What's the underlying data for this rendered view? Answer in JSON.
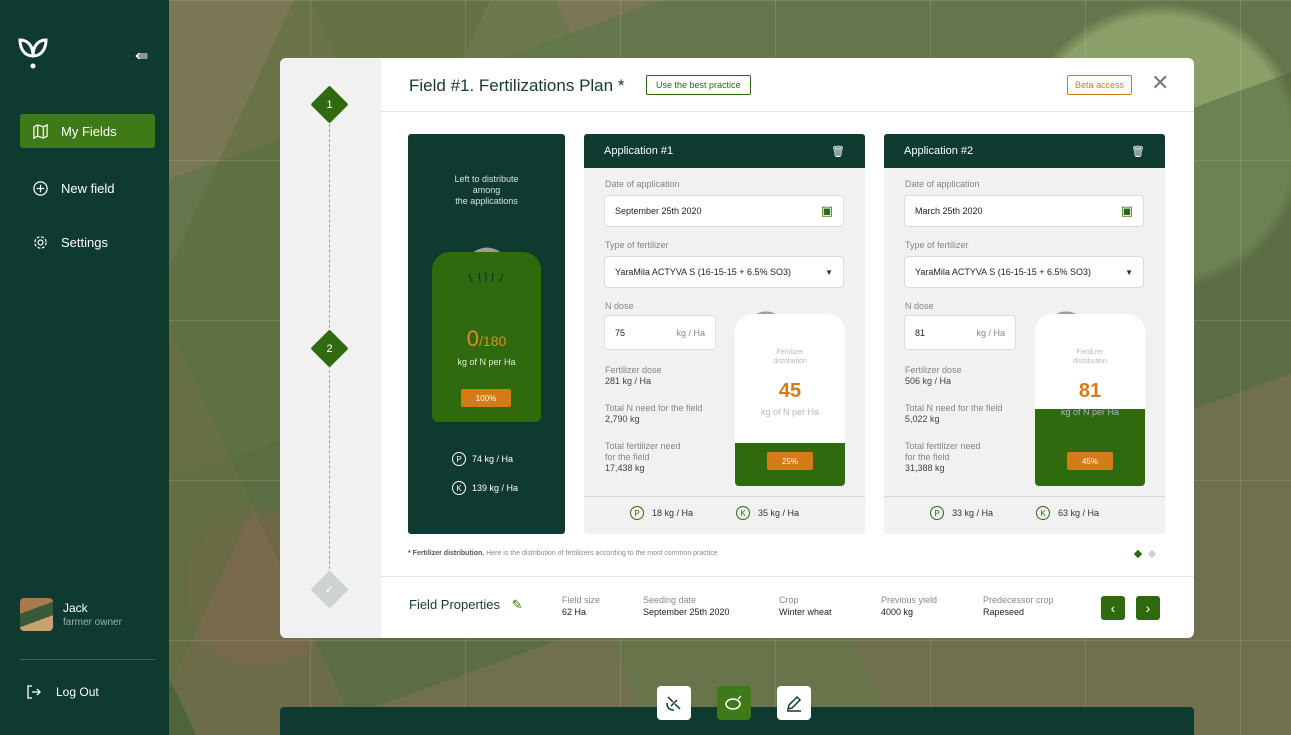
{
  "sidebar": {
    "items": [
      {
        "label": "My Fields",
        "icon": "map-icon"
      },
      {
        "label": "New field",
        "icon": "plus-circle-icon"
      },
      {
        "label": "Settings",
        "icon": "gear-icon"
      }
    ],
    "user": {
      "name": "Jack",
      "role": "farmer owner"
    },
    "logout_label": "Log Out"
  },
  "modal": {
    "title": "Field #1. Fertilizations Plan *",
    "best_practice_label": "Use the best practice",
    "beta_label": "Beta access",
    "steps": [
      "1",
      "2"
    ],
    "summary": {
      "title_line1": "Left to distribute",
      "title_line2": "among",
      "title_line3": "the applications",
      "value": "0",
      "total": "/180",
      "unit": "kg of N per Ha",
      "percent": "100%",
      "p_value": "74 kg / Ha",
      "k_value": "139 kg / Ha"
    },
    "applications": [
      {
        "title": "Application #1",
        "date_label": "Date of application",
        "date": "September 25th 2020",
        "type_label": "Type of fertilizer",
        "type": "YaraMila ACTYVA S (16-15-15 + 6.5% SO3)",
        "n_label": "N dose",
        "n_value": "75",
        "n_unit": "kg / Ha",
        "fert_dose_label": "Fertilizer dose",
        "fert_dose": "281 kg / Ha",
        "total_n_label": "Total N need for the field",
        "total_n": "2,790 kg",
        "total_fert_label1": "Total fertilizer need",
        "total_fert_label2": "for the field",
        "total_fert": "17,438 kg",
        "bag_label1": "Fertilizer",
        "bag_label2": "distribution",
        "bag_value": "45",
        "bag_unit": "kg of N per Ha",
        "bag_percent": "25%",
        "fill_fraction": 0.25,
        "p_value": "18 kg / Ha",
        "k_value": "35 kg / Ha"
      },
      {
        "title": "Application #2",
        "date_label": "Date of application",
        "date": "March 25th 2020",
        "type_label": "Type of fertilizer",
        "type": "YaraMila ACTYVA S (16-15-15 + 6.5% SO3)",
        "n_label": "N dose",
        "n_value": "81",
        "n_unit": "kg / Ha",
        "fert_dose_label": "Fertilizer dose",
        "fert_dose": "506 kg / Ha",
        "total_n_label": "Total N need for the field",
        "total_n": "5,022 kg",
        "total_fert_label1": "Total fertilizer need",
        "total_fert_label2": "for the field",
        "total_fert": "31,388 kg",
        "bag_label1": "Fertilizer",
        "bag_label2": "distribution",
        "bag_value": "81",
        "bag_unit": "kg of N per Ha",
        "bag_percent": "45%",
        "fill_fraction": 0.45,
        "p_value": "33 kg / Ha",
        "k_value": "63 kg / Ha"
      }
    ],
    "footnote_bold": "* Fertilizer distribution.",
    "footnote_text": " Here is the distribution of fertilizers according to the most common practice",
    "properties": {
      "title": "Field Properties",
      "field_size_label": "Field size",
      "field_size": "62 Ha",
      "seeding_label": "Seeding date",
      "seeding": "September 25th 2020",
      "crop_label": "Crop",
      "crop": "Winter wheat",
      "prev_yield_label": "Previous yield",
      "prev_yield": "4000 kg",
      "predecessor_label": "Predecessor crop",
      "predecessor": "Rapeseed"
    }
  },
  "colors": {
    "dark_green": "#0f3a30",
    "accent_green": "#2f6a0f",
    "orange": "#d47b17"
  }
}
